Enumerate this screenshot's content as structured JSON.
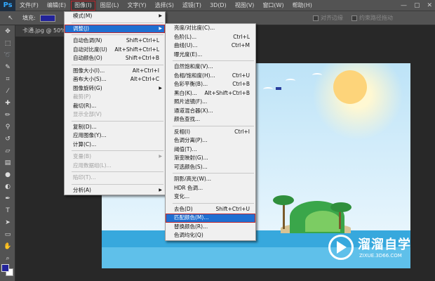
{
  "menubar": {
    "logo": "Ps",
    "items": [
      "文件(F)",
      "编辑(E)",
      "图像(I)",
      "图层(L)",
      "文字(Y)",
      "选择(S)",
      "滤镜(T)",
      "3D(D)",
      "视图(V)",
      "窗口(W)",
      "帮助(H)"
    ],
    "window_controls": [
      "—",
      "▢",
      "✕"
    ]
  },
  "options": {
    "fill_label": "填充:",
    "align_edges": "对齐边缘",
    "constrain_path": "约束路径拖动"
  },
  "document_tab": "卡通.jpg @ 50%(RG",
  "image_menu": {
    "items": [
      {
        "label": "模式(M)",
        "shortcut": "",
        "submenu": true
      },
      {
        "sep": true
      },
      {
        "label": "调整(J)",
        "shortcut": "",
        "submenu": true,
        "selected": true
      },
      {
        "sep": true
      },
      {
        "label": "自动色调(N)",
        "shortcut": "Shift+Ctrl+L"
      },
      {
        "label": "自动对比度(U)",
        "shortcut": "Alt+Shift+Ctrl+L"
      },
      {
        "label": "自动颜色(O)",
        "shortcut": "Shift+Ctrl+B"
      },
      {
        "sep": true
      },
      {
        "label": "图像大小(I)...",
        "shortcut": "Alt+Ctrl+I"
      },
      {
        "label": "画布大小(S)...",
        "shortcut": "Alt+Ctrl+C"
      },
      {
        "label": "图像旋转(G)",
        "shortcut": "",
        "submenu": true
      },
      {
        "label": "裁剪(P)",
        "shortcut": "",
        "disabled": true
      },
      {
        "label": "裁切(R)...",
        "shortcut": ""
      },
      {
        "label": "显示全部(V)",
        "shortcut": "",
        "disabled": true
      },
      {
        "sep": true
      },
      {
        "label": "复制(D)...",
        "shortcut": ""
      },
      {
        "label": "应用图像(Y)...",
        "shortcut": ""
      },
      {
        "label": "计算(C)...",
        "shortcut": ""
      },
      {
        "sep": true
      },
      {
        "label": "变量(B)",
        "shortcut": "",
        "submenu": true,
        "disabled": true
      },
      {
        "label": "应用数据组(L)...",
        "shortcut": "",
        "disabled": true
      },
      {
        "sep": true
      },
      {
        "label": "陷印(T)...",
        "shortcut": "",
        "disabled": true
      },
      {
        "sep": true
      },
      {
        "label": "分析(A)",
        "shortcut": "",
        "submenu": true
      }
    ]
  },
  "adjust_menu": {
    "items": [
      {
        "label": "亮度/对比度(C)...",
        "shortcut": ""
      },
      {
        "label": "色阶(L)...",
        "shortcut": "Ctrl+L"
      },
      {
        "label": "曲线(U)...",
        "shortcut": "Ctrl+M"
      },
      {
        "label": "曝光度(E)...",
        "shortcut": ""
      },
      {
        "sep": true
      },
      {
        "label": "自然饱和度(V)...",
        "shortcut": ""
      },
      {
        "label": "色相/饱和度(H)...",
        "shortcut": "Ctrl+U"
      },
      {
        "label": "色彩平衡(B)...",
        "shortcut": "Ctrl+B"
      },
      {
        "label": "黑白(K)...",
        "shortcut": "Alt+Shift+Ctrl+B"
      },
      {
        "label": "照片滤镜(F)...",
        "shortcut": ""
      },
      {
        "label": "通道混合器(X)...",
        "shortcut": ""
      },
      {
        "label": "颜色查找...",
        "shortcut": ""
      },
      {
        "sep": true
      },
      {
        "label": "反相(I)",
        "shortcut": "Ctrl+I"
      },
      {
        "label": "色调分离(P)...",
        "shortcut": ""
      },
      {
        "label": "阈值(T)...",
        "shortcut": ""
      },
      {
        "label": "渐变映射(G)...",
        "shortcut": ""
      },
      {
        "label": "可选颜色(S)...",
        "shortcut": ""
      },
      {
        "sep": true
      },
      {
        "label": "阴影/高光(W)...",
        "shortcut": ""
      },
      {
        "label": "HDR 色调...",
        "shortcut": ""
      },
      {
        "label": "变化...",
        "shortcut": ""
      },
      {
        "sep": true
      },
      {
        "label": "去色(D)",
        "shortcut": "Shift+Ctrl+U"
      },
      {
        "label": "匹配颜色(M)...",
        "shortcut": "",
        "selected": true
      },
      {
        "label": "替换颜色(R)...",
        "shortcut": ""
      },
      {
        "label": "色调均化(Q)",
        "shortcut": ""
      }
    ]
  },
  "watermark": {
    "title": "溜溜自学",
    "url": "ZIXUE.3D66.COM"
  },
  "colors": {
    "foreground": "#22239a",
    "background": "#ffffff",
    "highlight": "#c1272d",
    "selection": "#1f6fd1"
  }
}
